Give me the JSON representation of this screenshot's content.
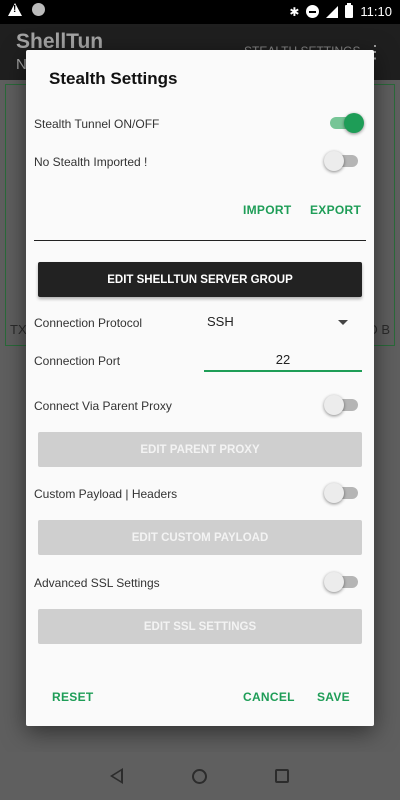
{
  "status_bar": {
    "time": "11:10",
    "icons": [
      "warning-icon",
      "notification-dot-icon",
      "bluetooth-icon",
      "do-not-disturb-icon",
      "signal-icon",
      "battery-icon"
    ]
  },
  "background_app": {
    "title": "ShellTun",
    "subtitle": "N",
    "menu_label": "STEALTH SETTINGS",
    "left_fragment": "TX",
    "right_fragment": "O B"
  },
  "dialog": {
    "title": "Stealth Settings",
    "stealth_tunnel": {
      "label": "Stealth Tunnel ON/OFF",
      "on": true
    },
    "stealth_imported": {
      "label": "No Stealth Imported !",
      "on": false
    },
    "import_label": "IMPORT",
    "export_label": "EXPORT",
    "server_group_button": "EDIT SHELLTUN SERVER GROUP",
    "protocol": {
      "label": "Connection Protocol",
      "value": "SSH"
    },
    "port": {
      "label": "Connection Port",
      "value": "22"
    },
    "parent_proxy": {
      "label": "Connect Via Parent Proxy",
      "on": false,
      "button": "EDIT PARENT PROXY"
    },
    "custom_payload": {
      "label": "Custom Payload | Headers",
      "on": false,
      "button": "EDIT CUSTOM PAYLOAD"
    },
    "ssl": {
      "label": "Advanced SSL Settings",
      "on": false,
      "button": "EDIT SSL SETTINGS"
    },
    "reset_label": "RESET",
    "cancel_label": "CANCEL",
    "save_label": "SAVE"
  },
  "colors": {
    "accent": "#1e9d57",
    "dialog_bg": "#fafafa",
    "dark_button": "#222222",
    "disabled_button": "#cfcfcf"
  }
}
